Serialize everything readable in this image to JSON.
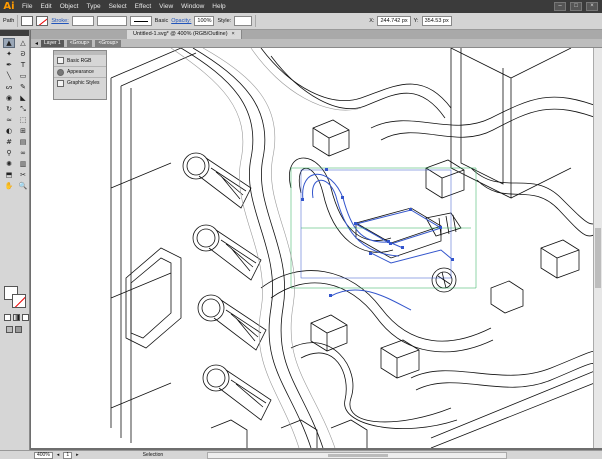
{
  "app": {
    "logo": "Ai",
    "accent_color": "#ff9a00"
  },
  "menubar": {
    "items": [
      "File",
      "Edit",
      "Object",
      "Type",
      "Select",
      "Effect",
      "View",
      "Window",
      "Help"
    ],
    "window_buttons": [
      "–",
      "□",
      "×"
    ]
  },
  "controlbar": {
    "selection_type": "Path",
    "stroke_label": "Stroke:",
    "brush_style": "Basic",
    "opacity_label": "Opacity:",
    "opacity_value": "100%",
    "style_label": "Style:",
    "x_label": "X:",
    "x_value": "244.742 px",
    "y_label": "Y:",
    "y_value": "354.53 px"
  },
  "document": {
    "tab_title": "Untitled-1.svg* @ 400% (RGB/Outline)",
    "close_glyph": "×"
  },
  "layerbar": {
    "layer": "Layer 1",
    "group1": "<Group>",
    "group2": "<Group>"
  },
  "panels": {
    "items": [
      {
        "label": "Basic RGB",
        "icon": "brush-icon"
      },
      {
        "label": "Appearance",
        "icon": "appearance-icon"
      },
      {
        "label": "Graphic Styles",
        "icon": "graphic-styles-icon"
      }
    ]
  },
  "tools": {
    "icons": [
      "selection-icon",
      "direct-selection-icon",
      "magic-wand-icon",
      "lasso-icon",
      "pen-icon",
      "type-icon",
      "line-icon",
      "rectangle-icon",
      "paintbrush-icon",
      "pencil-icon",
      "blob-brush-icon",
      "eraser-icon",
      "rotate-icon",
      "scale-icon",
      "width-icon",
      "free-transform-icon",
      "shape-builder-icon",
      "perspective-icon",
      "mesh-icon",
      "gradient-icon",
      "eyedropper-icon",
      "blend-icon",
      "symbol-sprayer-icon",
      "graph-icon",
      "artboard-icon",
      "slice-icon",
      "hand-icon",
      "zoom-icon"
    ],
    "glyphs": [
      "▲",
      "△",
      "✦",
      "ᘐ",
      "✒",
      "T",
      "╲",
      "▭",
      "ᔕ",
      "✎",
      "◉",
      "◣",
      "↻",
      "⤡",
      "≈",
      "⬚",
      "◐",
      "⊞",
      "#",
      "▤",
      "⚲",
      "∞",
      "✺",
      "▥",
      "⬒",
      "✂",
      "✋",
      "🔍"
    ]
  },
  "statusbar": {
    "zoom": "400%",
    "page": "1",
    "tool": "Selection"
  },
  "colors": {
    "menubar": "#3b3b3b",
    "controlbar": "#d4d4d4",
    "canvas": "#ffffff",
    "selection": "#3355cc",
    "artboard_guide": "#22aa55"
  }
}
